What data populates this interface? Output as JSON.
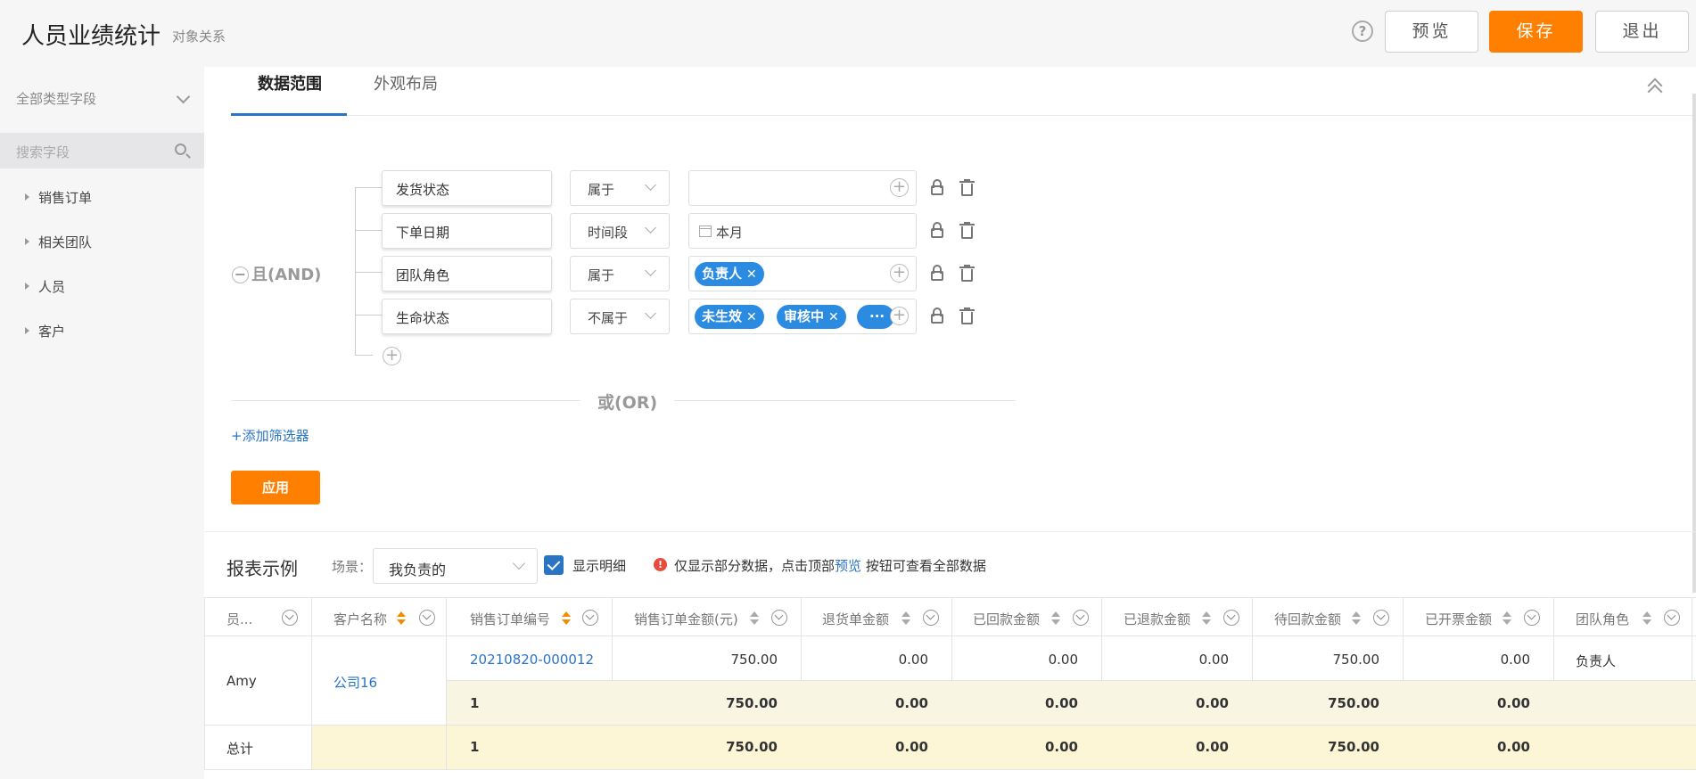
{
  "header": {
    "title": "人员业绩统计",
    "subtitle": "对象关系",
    "help_icon": "?",
    "preview": "预览",
    "save": "保存",
    "exit": "退出"
  },
  "sidebar": {
    "type_select": "全部类型字段",
    "search_placeholder": "搜索字段",
    "items": [
      "销售订单",
      "相关团队",
      "人员",
      "客户"
    ]
  },
  "tabs": [
    "数据范围",
    "外观布局"
  ],
  "filters": {
    "group_label": "且(AND)",
    "group_toggle": "−",
    "add_condition_icon": "+",
    "rows": [
      {
        "field": "发货状态",
        "operator": "属于",
        "value": "",
        "tags": []
      },
      {
        "field": "下单日期",
        "operator": "时间段",
        "value": "本月",
        "tags": []
      },
      {
        "field": "团队角色",
        "operator": "属于",
        "value": "",
        "tags": [
          "负责人"
        ]
      },
      {
        "field": "生命状态",
        "operator": "不属于",
        "value": "",
        "tags": [
          "未生效",
          "审核中"
        ],
        "more": "···"
      }
    ],
    "tag_close": "✕",
    "or_label": "或(OR)",
    "add_filter": "+添加筛选器",
    "apply": "应用"
  },
  "report": {
    "title": "报表示例",
    "scene_label": "场景：",
    "scene_value": "我负责的",
    "show_detail_label": "显示明细",
    "show_detail_checked": true,
    "warn_icon": "!",
    "notice_prefix": "仅显示部分数据，点击顶部",
    "notice_link": "预览",
    "notice_suffix": "按钮可查看全部数据"
  },
  "table": {
    "columns": [
      "员...",
      "客户名称",
      "销售订单编号",
      "销售订单金额(元)",
      "退货单金额",
      "已回款金额",
      "已退款金额",
      "待回款金额",
      "已开票金额",
      "团队角色"
    ],
    "detail_row": {
      "employee": "Amy",
      "customer": "公司16",
      "order_no": "20210820-000012",
      "amount": "750.00",
      "return_amount": "0.00",
      "paid": "0.00",
      "refunded": "0.00",
      "pending": "750.00",
      "invoiced": "0.00",
      "role": "负责人"
    },
    "subtotal_row": {
      "count": "1",
      "amount": "750.00",
      "return_amount": "0.00",
      "paid": "0.00",
      "refunded": "0.00",
      "pending": "750.00",
      "invoiced": "0.00"
    },
    "total_row": {
      "label": "总计",
      "count": "1",
      "amount": "750.00",
      "return_amount": "0.00",
      "paid": "0.00",
      "refunded": "0.00",
      "pending": "750.00",
      "invoiced": "0.00"
    }
  },
  "colors": {
    "accent_orange": "#ff7f00",
    "link_blue": "#2a74c6",
    "tag_blue": "#2a8be0",
    "subtotal_bg": "#f8f5e3",
    "total_bg": "#fdf6d6"
  }
}
